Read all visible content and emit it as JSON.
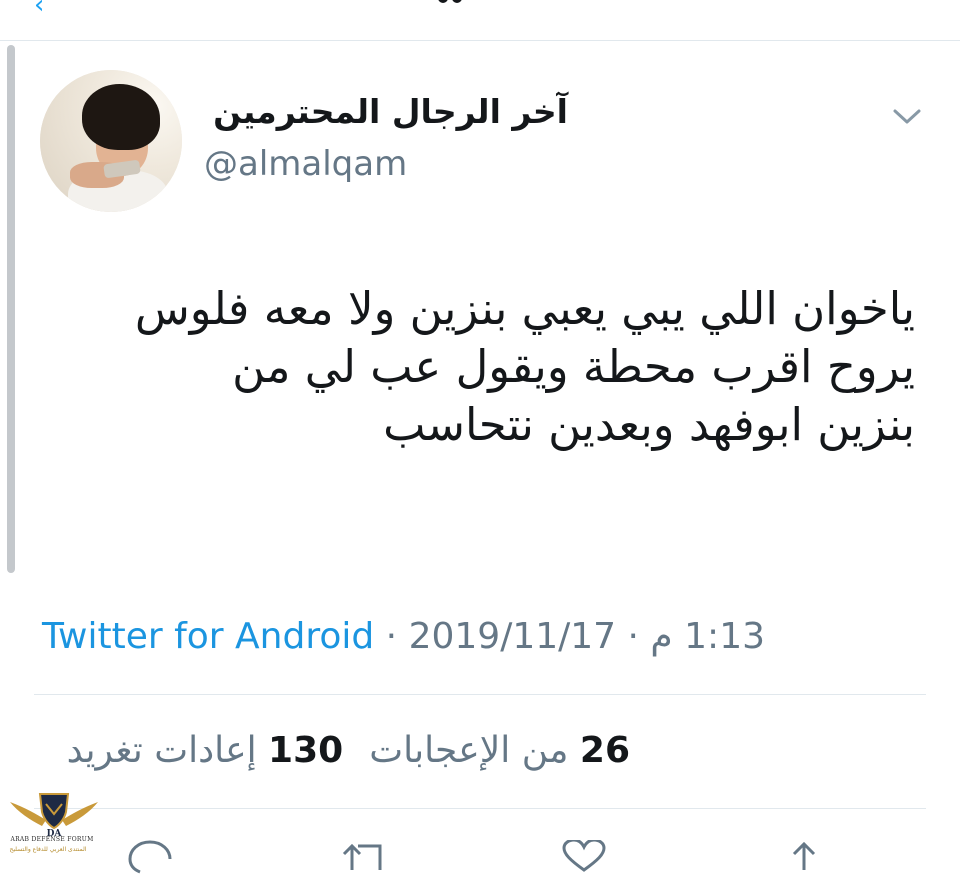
{
  "header": {
    "back_icon": "back-arrow-icon",
    "title_icon": "twitter-title-glyph"
  },
  "author": {
    "display_name": "آخر الرجال المحترمين",
    "handle": "@almalqam",
    "avatar_icon": "profile-photo-child-with-phone",
    "menu_icon": "chevron-down-icon"
  },
  "tweet": {
    "lines": [
      "ياخوان اللي يبي يعبي بنزين ولا معه فلوس",
      "يروح اقرب محطة ويقول عب لي من",
      "بنزين ابوفهد وبعدين نتحاسب"
    ]
  },
  "meta": {
    "time": "1:13 م",
    "separator": " · ",
    "date": "2019/11/17",
    "source": "Twitter for Android"
  },
  "stats": {
    "retweets_count": "130",
    "retweets_label": "إعادات تغريد",
    "likes_count": "26",
    "likes_label": "من الإعجابات"
  },
  "actions": {
    "reply_icon": "reply-icon",
    "retweet_icon": "retweet-icon",
    "like_icon": "heart-icon",
    "share_icon": "share-icon"
  },
  "watermark": {
    "line1": "ARAB DEFENSE FORUM",
    "line2": "المنتدى العربي للدفاع والتسليح",
    "logo_text": "DA",
    "logo_icon": "eagle-wings-logo"
  },
  "colors": {
    "link": "#1b95e0",
    "secondary_text": "#657786",
    "primary_text": "#14171a",
    "divider": "#e1e8ed"
  }
}
